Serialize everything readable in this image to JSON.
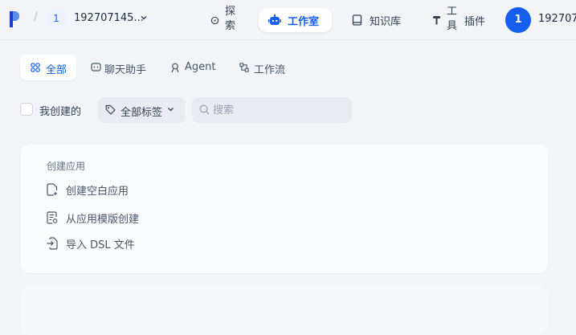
{
  "header": {
    "separator": "/",
    "workspace_badge": "1",
    "workspace_name": "192707145...",
    "nav": {
      "explore": "探索",
      "studio": "工作室",
      "knowledge": "知识库",
      "tools": "工具",
      "plugins": "插件"
    },
    "avatar_initial": "1",
    "user_name": "192707"
  },
  "tabs": {
    "all": "全部",
    "chat": "聊天助手",
    "agent": "Agent",
    "workflow": "工作流"
  },
  "filters": {
    "created_by_me": "我创建的",
    "all_tags": "全部标签",
    "search_placeholder": "搜索"
  },
  "create_app": {
    "title": "创建应用",
    "items": [
      "创建空白应用",
      "从应用模版创建",
      "导入 DSL 文件"
    ]
  },
  "colors": {
    "accent": "#155eef",
    "background": "#f2f4f7"
  }
}
